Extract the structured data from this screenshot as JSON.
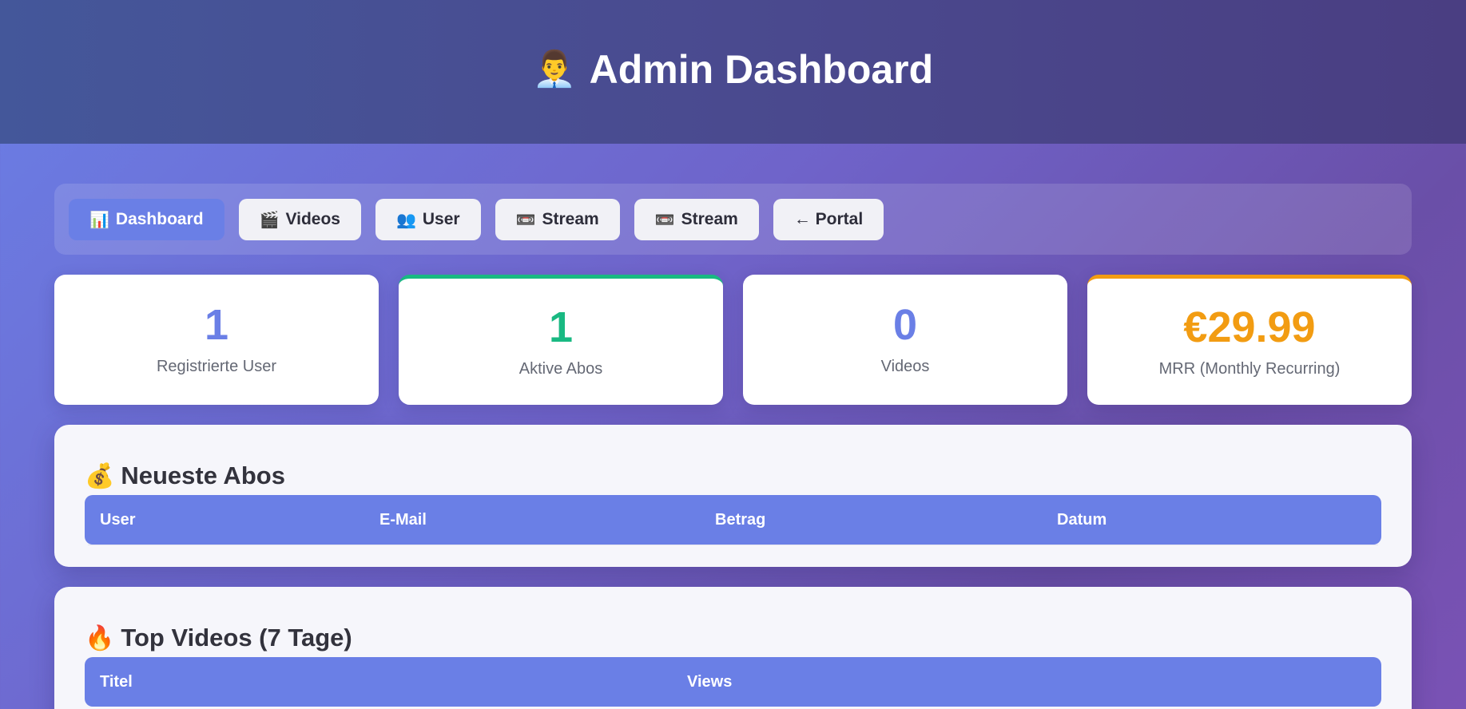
{
  "header": {
    "icon": "👨‍💼",
    "icon_name": "admin-person-icon",
    "title": "Admin Dashboard"
  },
  "nav": {
    "items": [
      {
        "icon": "📊",
        "icon_name": "bar-chart-icon",
        "label": "Dashboard",
        "active": true
      },
      {
        "icon": "🎬",
        "icon_name": "clapperboard-icon",
        "label": "Videos"
      },
      {
        "icon": "👥",
        "icon_name": "users-icon",
        "label": "User"
      },
      {
        "icon": "📼",
        "icon_name": "videocassette-icon",
        "label": "Stream"
      },
      {
        "icon": "📼",
        "icon_name": "videocassette-icon",
        "label": "Stream"
      },
      {
        "icon": "",
        "icon_name": "",
        "label": "← Portal"
      }
    ]
  },
  "stats": [
    {
      "value": "1",
      "label": "Registrierte User",
      "color": "#6a7fe6"
    },
    {
      "value": "1",
      "label": "Aktive Abos",
      "color": "#19b982"
    },
    {
      "value": "0",
      "label": "Videos",
      "color": "#6a7fe6"
    },
    {
      "value": "€29.99",
      "label": "MRR (Monthly Recurring)",
      "color": "#f29c12"
    }
  ],
  "subscriptions": {
    "icon": "💰",
    "icon_name": "money-bag-icon",
    "title": "Neueste Abos",
    "columns": [
      "User",
      "E-Mail",
      "Betrag",
      "Datum"
    ]
  },
  "top_videos": {
    "icon": "🔥",
    "icon_name": "fire-icon",
    "title": "Top Videos (7 Tage)",
    "columns": [
      "Titel",
      "Views"
    ]
  },
  "colors": {
    "accent": "#6a7fe6",
    "green": "#19b982",
    "orange": "#f29c12"
  }
}
